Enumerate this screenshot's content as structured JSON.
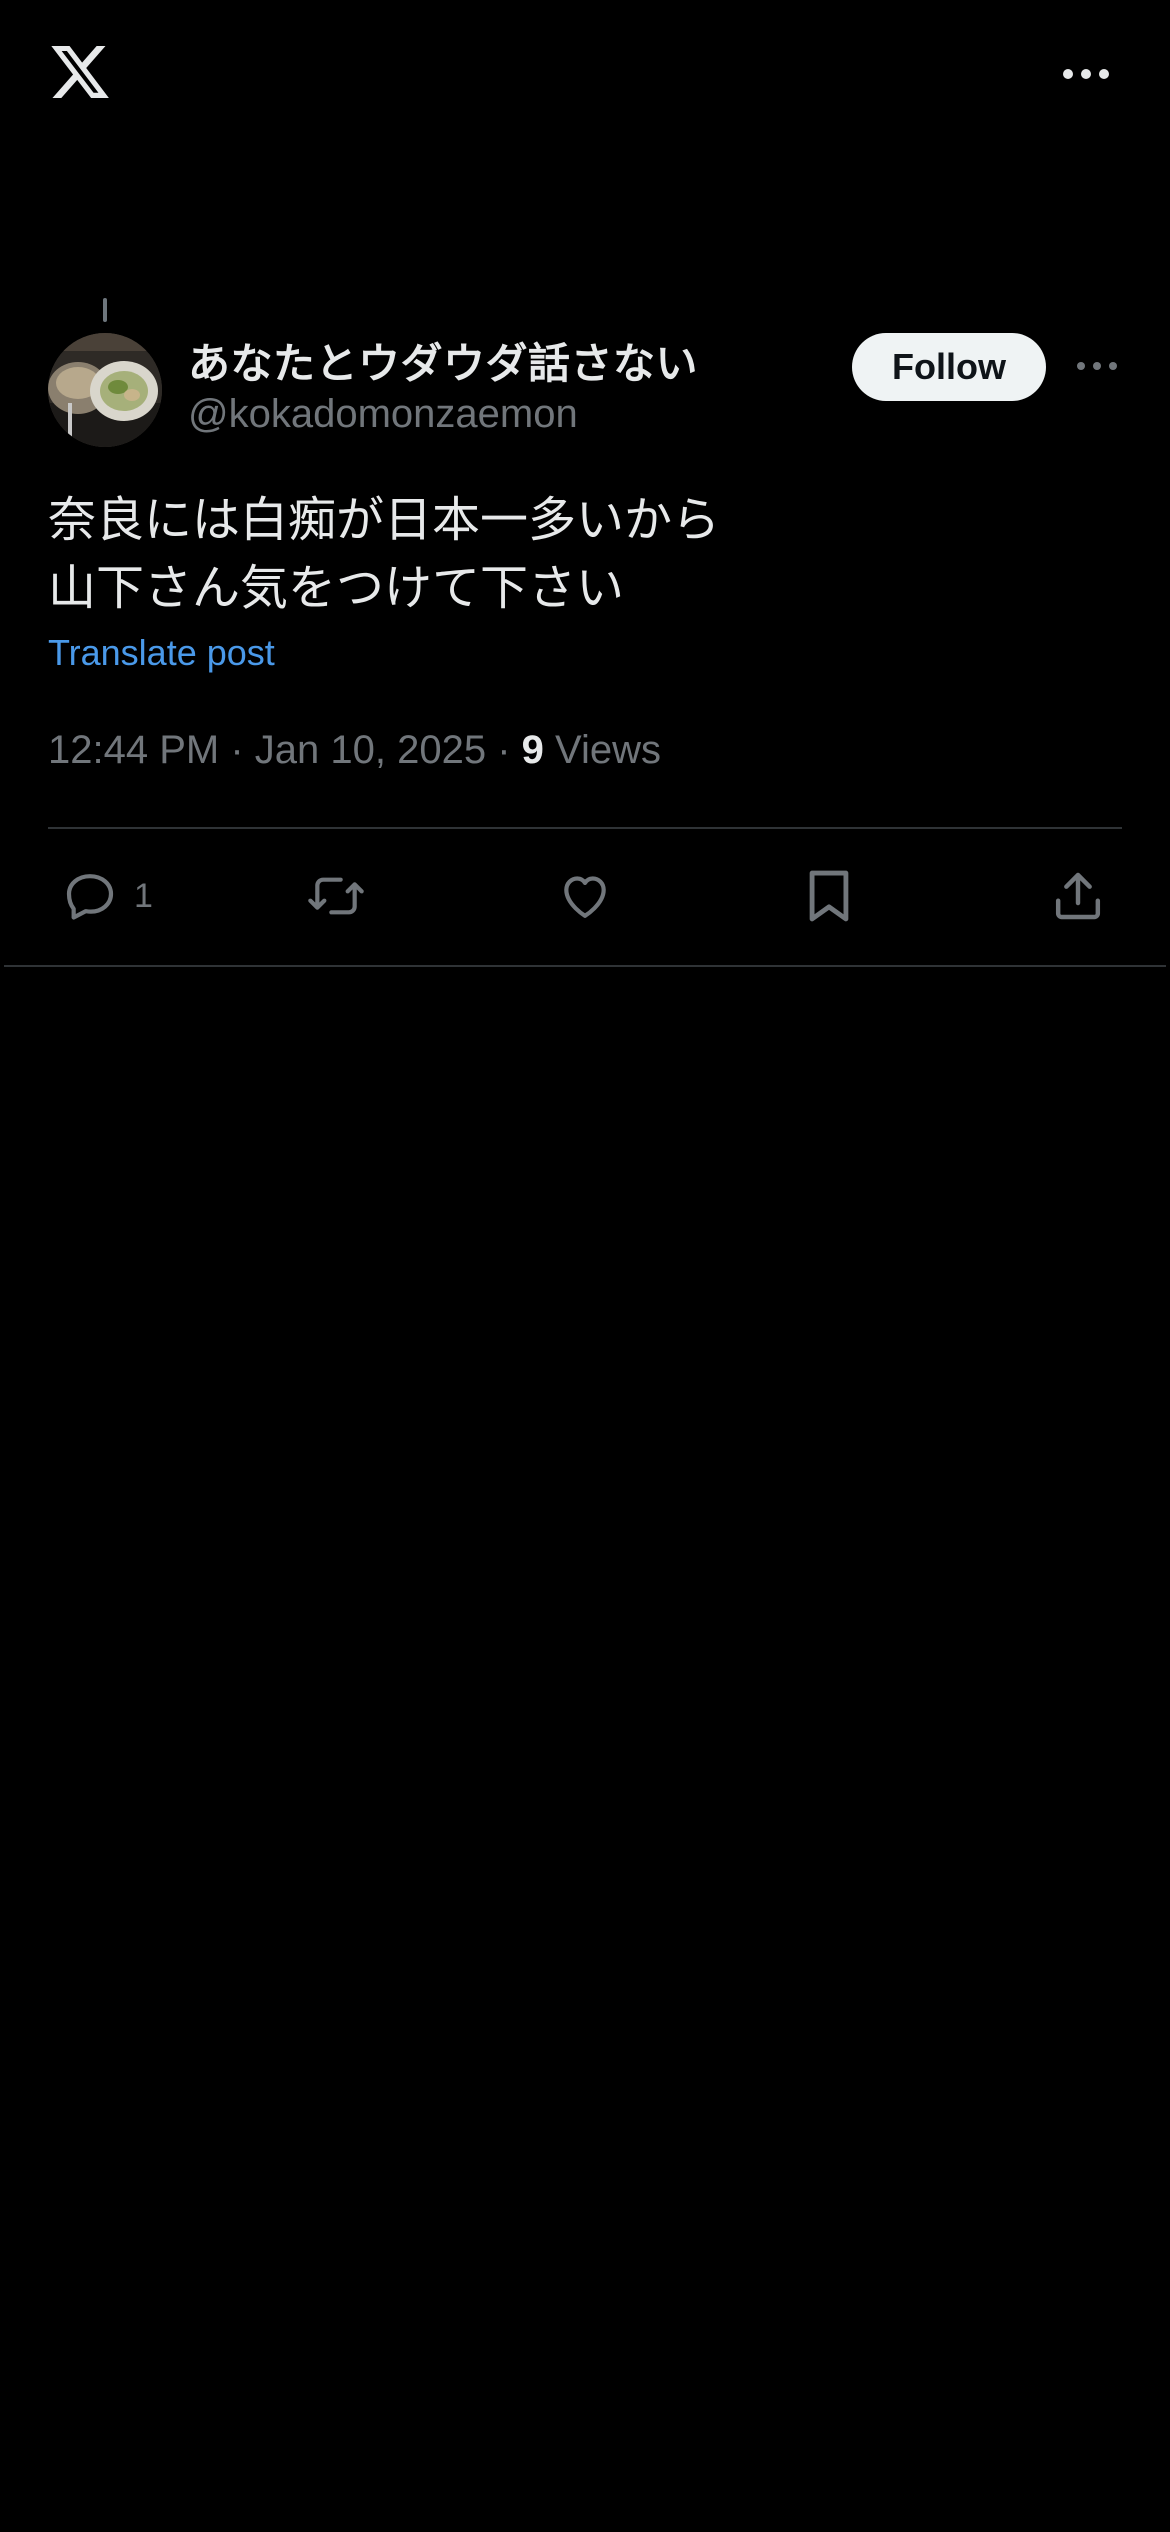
{
  "topbar": {
    "logo_icon": "x-logo-icon",
    "more_icon": "more-horizontal-icon"
  },
  "author": {
    "display_name": "あなたとウダウダ話さない",
    "handle": "@kokadomonzaemon",
    "avatar_icon": "avatar-food-photo"
  },
  "follow_button": {
    "label": "Follow"
  },
  "post": {
    "text_lines": [
      "奈良には白痴が日本一多いから",
      "山下さん気をつけて下さい"
    ],
    "translate_label": "Translate post",
    "time": "12:44 PM",
    "separator": " · ",
    "date": "Jan 10, 2025",
    "views_count": "9",
    "views_label": " Views"
  },
  "actions": {
    "reply_count": "1",
    "reply_icon": "reply-icon",
    "repost_icon": "repost-icon",
    "like_icon": "heart-icon",
    "bookmark_icon": "bookmark-icon",
    "share_icon": "share-icon"
  },
  "colors": {
    "background": "#000000",
    "text_primary": "#e7e9ea",
    "text_secondary": "#71767b",
    "link": "#4a99e9",
    "divider": "#2f3336",
    "follow_bg": "#eff3f4"
  }
}
